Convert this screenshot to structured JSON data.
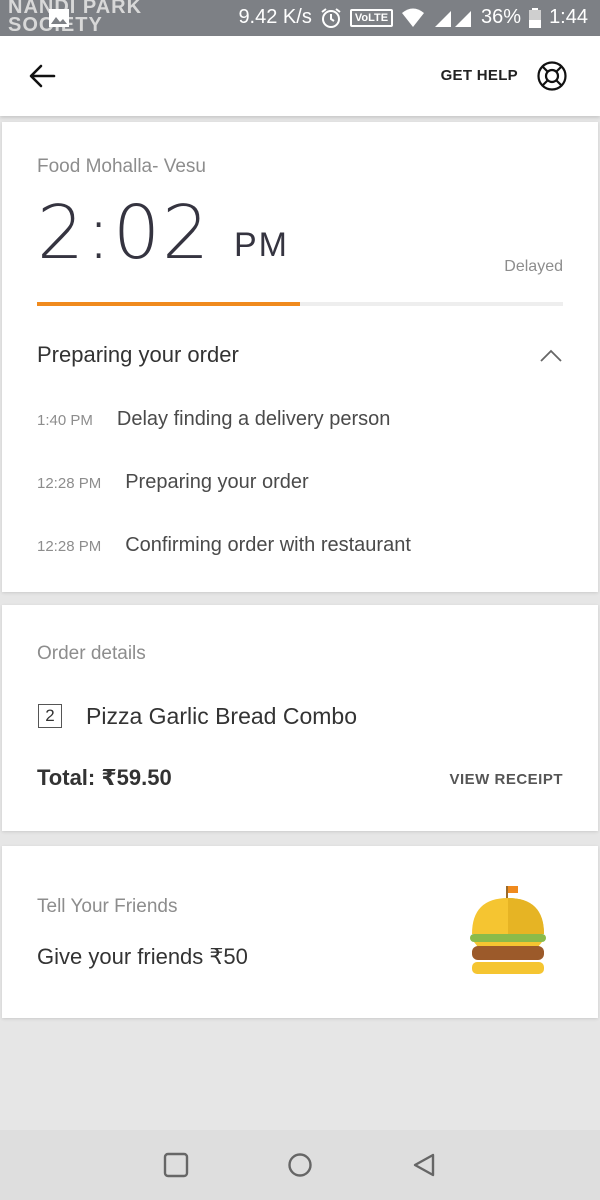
{
  "status_bar": {
    "map_text": "NANDI PARK",
    "map_text_2": "SOCIETY",
    "network_speed": "9.42 K/s",
    "volte": "VoLTE",
    "battery": "36%",
    "time": "1:44"
  },
  "header": {
    "back_icon": "arrow-left-icon",
    "get_help_label": "GET HELP",
    "help_icon": "lifebuoy-icon"
  },
  "order_status": {
    "restaurant": "Food Mohalla- Vesu",
    "eta_time": "2:02",
    "eta_ampm": "PM",
    "eta_status": "Delayed",
    "progress": 0.5,
    "status_title": "Preparing your order",
    "timeline": [
      {
        "time": "1:40 PM",
        "text": "Delay finding a delivery person"
      },
      {
        "time": "12:28 PM",
        "text": "Preparing your order"
      },
      {
        "time": "12:28 PM",
        "text": "Confirming order with restaurant"
      }
    ]
  },
  "order_details": {
    "label": "Order details",
    "items": [
      {
        "qty": "2",
        "name": "Pizza Garlic Bread Combo"
      }
    ],
    "total": "Total: ₹59.50",
    "view_receipt": "VIEW RECEIPT"
  },
  "referral": {
    "label": "Tell Your Friends",
    "text": "Give your friends ₹50",
    "icon": "burger-icon"
  },
  "colors": {
    "accent": "#f08a1d",
    "text_dark": "#353440",
    "text_muted": "#8d8d8d"
  },
  "nav": {
    "recents_icon": "square-icon",
    "home_icon": "circle-icon",
    "back_icon": "triangle-back-icon"
  }
}
